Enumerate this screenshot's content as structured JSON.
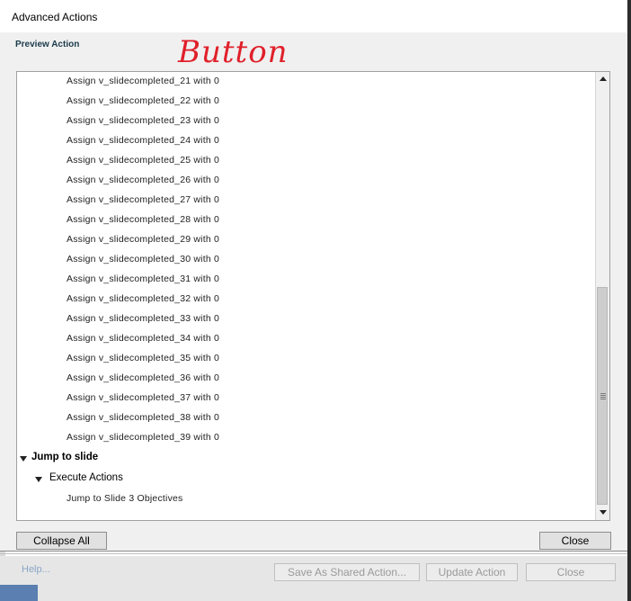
{
  "window": {
    "title": "Advanced Actions"
  },
  "section": {
    "label": "Preview Action"
  },
  "annotation": {
    "text": "Button",
    "color": "#e0202a"
  },
  "list": {
    "assign_rows": [
      "Assign v_slidecompleted_21 with 0",
      "Assign v_slidecompleted_22 with 0",
      "Assign v_slidecompleted_23 with 0",
      "Assign v_slidecompleted_24 with 0",
      "Assign v_slidecompleted_25 with 0",
      "Assign v_slidecompleted_26 with 0",
      "Assign v_slidecompleted_27 with 0",
      "Assign v_slidecompleted_28 with 0",
      "Assign v_slidecompleted_29 with 0",
      "Assign v_slidecompleted_30 with 0",
      "Assign v_slidecompleted_31 with 0",
      "Assign v_slidecompleted_32 with 0",
      "Assign v_slidecompleted_33 with 0",
      "Assign v_slidecompleted_34 with 0",
      "Assign v_slidecompleted_35 with 0",
      "Assign v_slidecompleted_36 with 0",
      "Assign v_slidecompleted_37 with 0",
      "Assign v_slidecompleted_38 with 0",
      "Assign v_slidecompleted_39 with 0"
    ],
    "jump_group": "Jump to slide",
    "execute_group": "Execute Actions",
    "jump_action": "Jump to Slide 3 Objectives"
  },
  "buttons": {
    "collapse_all": "Collapse All",
    "close": "Close"
  },
  "background_dialog": {
    "help": "Help...",
    "save_shared": "Save As Shared Action...",
    "update_action": "Update Action",
    "close": "Close"
  }
}
